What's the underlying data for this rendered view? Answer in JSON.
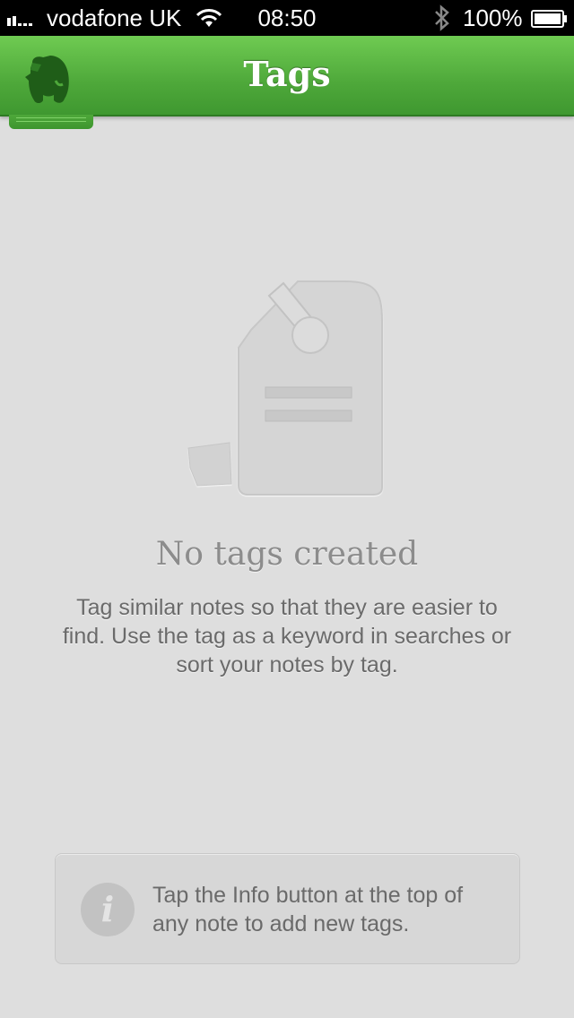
{
  "status_bar": {
    "carrier": "vodafone UK",
    "time": "08:50",
    "battery": "100%"
  },
  "nav": {
    "title": "Tags",
    "logo_icon": "evernote-elephant-icon"
  },
  "empty_state": {
    "illustration": "tag-icon",
    "title": "No tags created",
    "description": "Tag similar notes so that they are easier to find. Use the tag as a keyword in searches or sort your notes by tag."
  },
  "tip": {
    "icon": "info-icon",
    "icon_glyph": "i",
    "text": "Tap the Info button at the top of any note to add new tags."
  },
  "colors": {
    "nav_green": "#4ea83a",
    "background": "#dedede"
  }
}
